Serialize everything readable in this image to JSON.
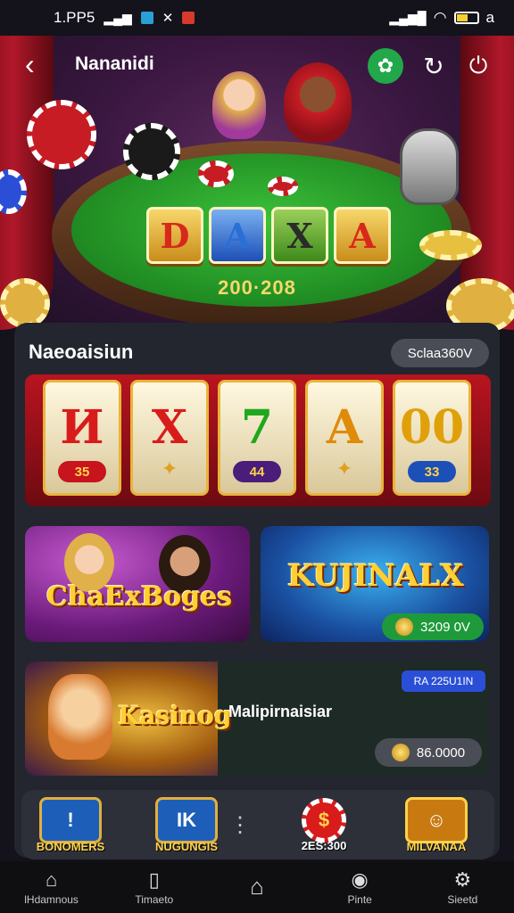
{
  "status_bar": {
    "time": "1.PP5",
    "battery_suffix": "a"
  },
  "header": {
    "title": "Nananidi"
  },
  "hero": {
    "tiles": [
      "D",
      "A",
      "X",
      "A"
    ],
    "tile_colors": [
      "#d8281c",
      "#2a6fd6",
      "#2b2b2b",
      "#d8281c"
    ],
    "jackpot": "200·208"
  },
  "section": {
    "title": "Naeoaisiun",
    "pill": "Sclaa360V"
  },
  "slots": {
    "reels": [
      {
        "symbol": "И",
        "value": "35",
        "color": "#d81c1c",
        "badge": "#c8141c"
      },
      {
        "symbol": "X",
        "value": "",
        "color": "#d81c1c",
        "badge": ""
      },
      {
        "symbol": "7",
        "value": "44",
        "color": "#1fa81f",
        "badge": "#4a1d7a"
      },
      {
        "symbol": "A",
        "value": "",
        "color": "#e08a0a",
        "badge": ""
      },
      {
        "symbol": "00",
        "value": "33",
        "color": "#e0a00a",
        "badge": "#1d4fb8"
      }
    ]
  },
  "cards": {
    "card1": {
      "title": "ChaExBoges"
    },
    "card2": {
      "title": "KUJINALX",
      "amount": "3209 0V"
    },
    "card3": {
      "title": "Kasinog",
      "label": "Malipirnaisiar",
      "tag": "RA 225U1IN",
      "amount": "86.0000"
    }
  },
  "dock": [
    {
      "label": "BONOMERS",
      "glyph": "!",
      "color": "#1d5fb8"
    },
    {
      "label": "NUGUNGIS",
      "glyph": "IK",
      "color": "#1d5fb8"
    },
    {
      "label": "⋮",
      "glyph": "",
      "color": ""
    },
    {
      "label": "2ES:300",
      "glyph": "$",
      "color": "#d81c1c"
    },
    {
      "label": "MILVANAA",
      "glyph": "☺",
      "color": "#c87a10"
    }
  ],
  "nav": [
    {
      "label": "lHdamnous",
      "icon": "home-icon"
    },
    {
      "label": "Timaeto",
      "icon": "tablet-icon"
    },
    {
      "label": "",
      "icon": "house-outline-icon"
    },
    {
      "label": "Pinte",
      "icon": "pin-icon"
    },
    {
      "label": "Sieetd",
      "icon": "settings-icon"
    }
  ]
}
